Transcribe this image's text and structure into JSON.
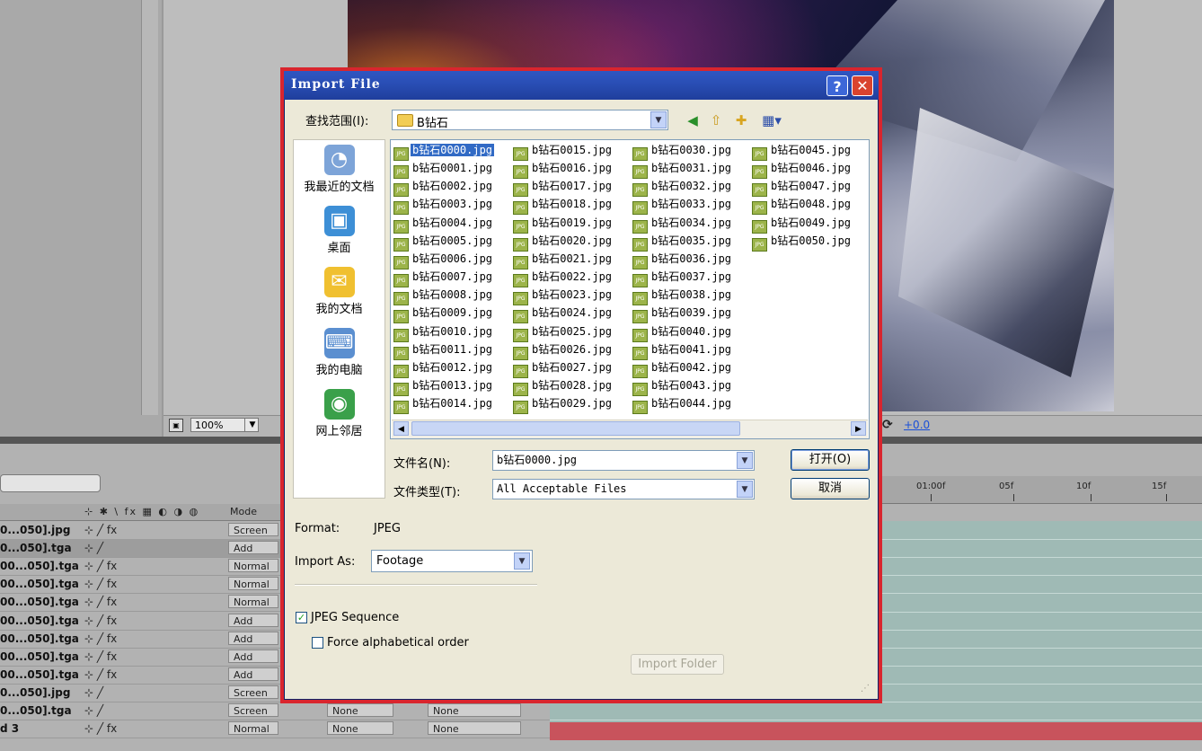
{
  "dialog": {
    "title": "Import File",
    "help_label": "?",
    "close_label": "✕",
    "lookin_label": "查找范围(I):",
    "lookin_value": "B钻石",
    "places": [
      "我最近的文档",
      "桌面",
      "我的文档",
      "我的电脑",
      "网上邻居"
    ],
    "files": [
      "b钻石0000.jpg",
      "b钻石0001.jpg",
      "b钻石0002.jpg",
      "b钻石0003.jpg",
      "b钻石0004.jpg",
      "b钻石0005.jpg",
      "b钻石0006.jpg",
      "b钻石0007.jpg",
      "b钻石0008.jpg",
      "b钻石0009.jpg",
      "b钻石0010.jpg",
      "b钻石0011.jpg",
      "b钻石0012.jpg",
      "b钻石0013.jpg",
      "b钻石0014.jpg",
      "b钻石0015.jpg",
      "b钻石0016.jpg",
      "b钻石0017.jpg",
      "b钻石0018.jpg",
      "b钻石0019.jpg",
      "b钻石0020.jpg",
      "b钻石0021.jpg",
      "b钻石0022.jpg",
      "b钻石0023.jpg",
      "b钻石0024.jpg",
      "b钻石0025.jpg",
      "b钻石0026.jpg",
      "b钻石0027.jpg",
      "b钻石0028.jpg",
      "b钻石0029.jpg",
      "b钻石0030.jpg",
      "b钻石0031.jpg",
      "b钻石0032.jpg",
      "b钻石0033.jpg",
      "b钻石0034.jpg",
      "b钻石0035.jpg",
      "b钻石0036.jpg",
      "b钻石0037.jpg",
      "b钻石0038.jpg",
      "b钻石0039.jpg",
      "b钻石0040.jpg",
      "b钻石0041.jpg",
      "b钻石0042.jpg",
      "b钻石0043.jpg",
      "b钻石0044.jpg",
      "b钻石0045.jpg",
      "b钻石0046.jpg",
      "b钻石0047.jpg",
      "b钻石0048.jpg",
      "b钻石0049.jpg",
      "b钻石0050.jpg"
    ],
    "selected_file": "b钻石0000.jpg",
    "file_icon_text": "JPG",
    "filename_label": "文件名(N):",
    "filename_value": "b钻石0000.jpg",
    "filetype_label": "文件类型(T):",
    "filetype_value": "All Acceptable Files",
    "open_label": "打开(O)",
    "cancel_label": "取消",
    "format_label": "Format:",
    "format_value": "JPEG",
    "import_as_label": "Import As:",
    "import_as_value": "Footage",
    "sequence_label": "JPEG Sequence",
    "sequence_checked": true,
    "alpha_order_label": "Force alphabetical order",
    "alpha_order_checked": false,
    "import_folder_label": "Import Folder"
  },
  "viewer": {
    "zoom": "100%",
    "exposure": "+0.0"
  },
  "timeline": {
    "mode_header": "Mode",
    "header_icons": "⊹ ✱ \\ fx ▦ ◐ ◑ ◍",
    "ruler_ticks": [
      "01:00f",
      "05f",
      "10f",
      "15f"
    ],
    "layers": [
      {
        "name": "0...050].jpg",
        "fx": "fx",
        "mode": "Screen"
      },
      {
        "name": "0...050].tga",
        "fx": "",
        "mode": "Add"
      },
      {
        "name": "00...050].tga",
        "fx": "fx",
        "mode": "Normal"
      },
      {
        "name": "00...050].tga",
        "fx": "fx",
        "mode": "Normal"
      },
      {
        "name": "00...050].tga",
        "fx": "fx",
        "mode": "Normal"
      },
      {
        "name": "00...050].tga",
        "fx": "fx",
        "mode": "Add"
      },
      {
        "name": "00...050].tga",
        "fx": "fx",
        "mode": "Add"
      },
      {
        "name": "00...050].tga",
        "fx": "fx",
        "mode": "Add"
      },
      {
        "name": "00...050].tga",
        "fx": "fx",
        "mode": "Add"
      },
      {
        "name": "0...050].jpg",
        "fx": "",
        "mode": "Screen"
      },
      {
        "name": "0...050].tga",
        "fx": "",
        "mode": "Screen",
        "trkmat": "None",
        "parent": "None"
      },
      {
        "name": "d 3",
        "fx": "fx",
        "mode": "Normal",
        "trkmat": "None",
        "parent": "None"
      }
    ]
  }
}
